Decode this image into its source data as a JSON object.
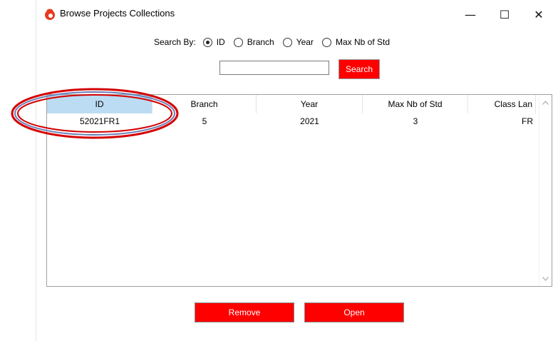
{
  "window": {
    "title": "Browse Projects Collections",
    "minimize_glyph": "—",
    "maximize_glyph": "☐",
    "close_glyph": "✕",
    "icon": "app-logo-icon"
  },
  "search": {
    "search_by_label": "Search By:",
    "options": [
      {
        "label": "ID",
        "selected": true
      },
      {
        "label": "Branch",
        "selected": false
      },
      {
        "label": "Year",
        "selected": false
      },
      {
        "label": "Max Nb of Std",
        "selected": false
      }
    ],
    "input_value": "",
    "button_label": "Search"
  },
  "table": {
    "columns": [
      "ID",
      "Branch",
      "Year",
      "Max Nb of Std",
      "Class Lan"
    ],
    "rows": [
      [
        "52021FR1",
        "5",
        "2021",
        "3",
        "FR"
      ]
    ]
  },
  "actions": {
    "remove_label": "Remove",
    "open_label": "Open"
  },
  "colors": {
    "accent": "#ff0000",
    "selected_header": "#bcdcf4",
    "annotation_ellipse": "#d40000"
  }
}
